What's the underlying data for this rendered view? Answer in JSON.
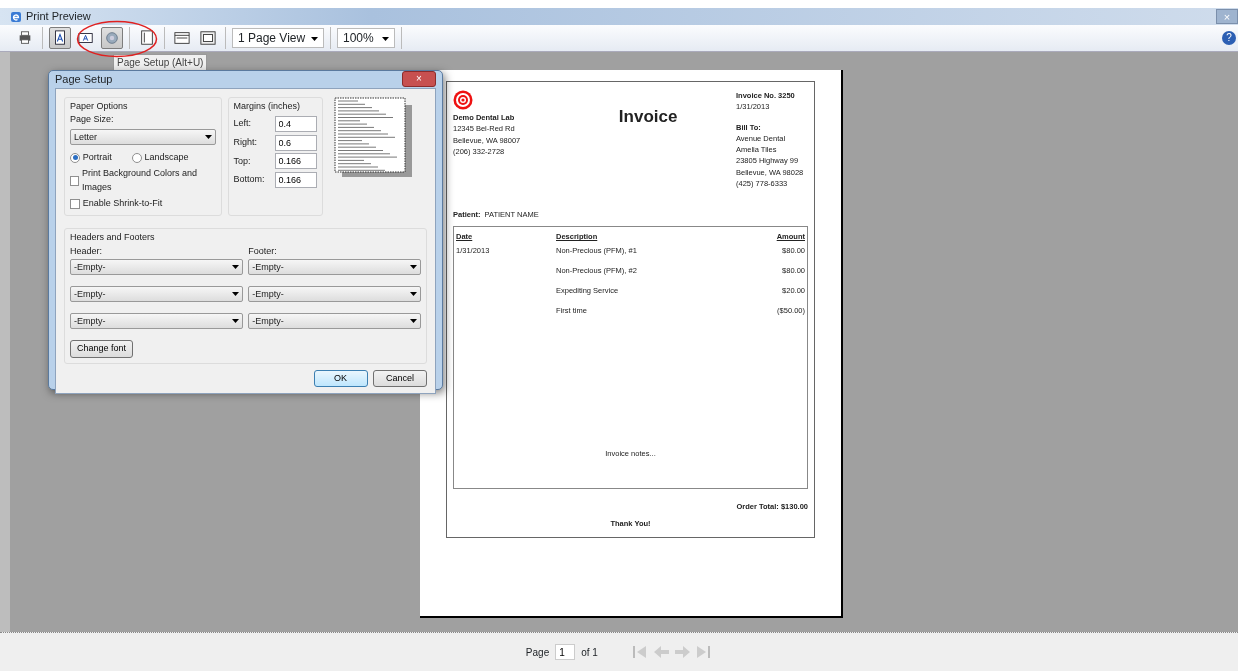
{
  "window": {
    "title": "Print Preview",
    "close": "×",
    "help": "?"
  },
  "toolbar": {
    "buttons": [
      {
        "kind": "print",
        "selected": false
      },
      {
        "kind": "portrait",
        "selected": true
      },
      {
        "kind": "landscape",
        "selected": false
      },
      {
        "kind": "gear",
        "selected": true
      },
      {
        "kind": "headers",
        "selected": false
      },
      {
        "kind": "fit-width",
        "selected": false
      },
      {
        "kind": "full-page",
        "selected": false
      }
    ],
    "view": "1 Page View",
    "zoom": "100%",
    "tooltip": "Page Setup (Alt+U)"
  },
  "dialog": {
    "title": "Page Setup",
    "close": "×",
    "paper_options": {
      "legend": "Paper Options",
      "page_size_label": "Page Size:",
      "page_size": "Letter",
      "orientation": [
        {
          "label": "Portrait",
          "selected": true
        },
        {
          "label": "Landscape",
          "selected": false
        }
      ],
      "checkboxes": [
        {
          "label": "Print Background Colors and Images",
          "checked": false
        },
        {
          "label": "Enable Shrink-to-Fit",
          "checked": false
        }
      ]
    },
    "margins": {
      "legend": "Margins (inches)",
      "fields": [
        {
          "label": "Left:",
          "value": "0.4"
        },
        {
          "label": "Right:",
          "value": "0.6"
        },
        {
          "label": "Top:",
          "value": "0.166"
        },
        {
          "label": "Bottom:",
          "value": "0.166"
        }
      ]
    },
    "headers_footers": {
      "legend": "Headers and Footers",
      "header_label": "Header:",
      "footer_label": "Footer:",
      "header": [
        "-Empty-",
        "-Empty-",
        "-Empty-"
      ],
      "footer": [
        "-Empty-",
        "-Empty-",
        "-Empty-"
      ],
      "change_font": "Change font"
    },
    "buttons": [
      {
        "label": "OK",
        "default": true
      },
      {
        "label": "Cancel",
        "default": false
      }
    ]
  },
  "invoice": {
    "company": "Demo Dental Lab",
    "address": [
      "12345 Bel-Red Rd",
      "Bellevue, WA 98007",
      "(206) 332-2728"
    ],
    "title": "Invoice",
    "number": "Invoice No. 3250",
    "date": "1/31/2013",
    "bill_to_label": "Bill To:",
    "bill_to": [
      "Avenue Dental",
      "Amelia Tiles",
      "23805 Highway 99",
      "Bellevue, WA 98028",
      "(425) 778-6333"
    ],
    "patient_label": "Patient:",
    "patient": "PATIENT NAME",
    "columns": [
      "Date",
      "Description",
      "Amount"
    ],
    "rows": [
      {
        "date": "1/31/2013",
        "description": "Non-Precious (PFM), #1",
        "amount": "$80.00"
      },
      {
        "date": "",
        "description": "Non-Precious (PFM), #2",
        "amount": "$80.00"
      },
      {
        "date": "",
        "description": "Expediting Service",
        "amount": "$20.00"
      },
      {
        "date": "",
        "description": "First time",
        "amount": "($50.00)"
      }
    ],
    "notes": "Invoice notes...",
    "total": "Order Total: $130.00",
    "thanks": "Thank You!"
  },
  "pager": {
    "page_label": "Page",
    "page": "1",
    "of": "of 1"
  }
}
